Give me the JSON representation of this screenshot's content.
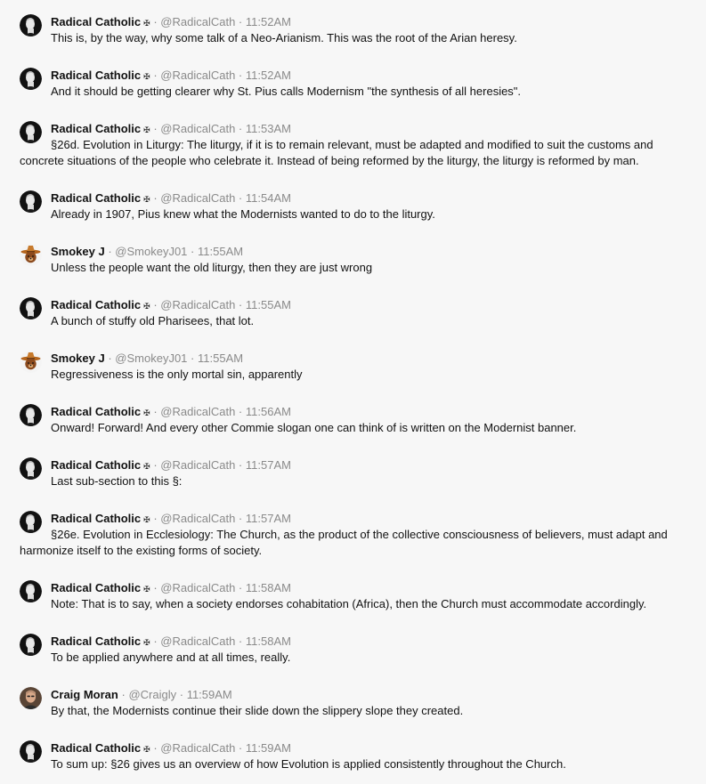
{
  "users": {
    "radical": {
      "name": "Radical Catholic",
      "badge": "✠",
      "handle": "@RadicalCath",
      "avatar": "radical-avatar-icon"
    },
    "smokey": {
      "name": "Smokey J",
      "handle": "@SmokeyJ01",
      "avatar": "smokey-bear-avatar-icon"
    },
    "craig": {
      "name": "Craig Moran",
      "handle": "@Craigly",
      "avatar": "craig-avatar-icon"
    }
  },
  "separator": "·",
  "posts": [
    {
      "user": "radical",
      "name": "Radical Catholic",
      "badge": "✠",
      "handle": "@RadicalCath",
      "time": "11:52AM",
      "text": "This is, by the way, why some talk of a Neo-Arianism. This was the root of the Arian heresy."
    },
    {
      "user": "radical",
      "name": "Radical Catholic",
      "badge": "✠",
      "handle": "@RadicalCath",
      "time": "11:52AM",
      "text": "And it should be getting clearer why St. Pius calls Modernism \"the synthesis of all heresies\"."
    },
    {
      "user": "radical",
      "name": "Radical Catholic",
      "badge": "✠",
      "handle": "@RadicalCath",
      "time": "11:53AM",
      "text": "§26d. Evolution in Liturgy: The liturgy, if it is to remain relevant, must be adapted and modified to suit the customs and concrete situations of the people who celebrate it. Instead of being reformed by the liturgy, the liturgy is reformed by man."
    },
    {
      "user": "radical",
      "name": "Radical Catholic",
      "badge": "✠",
      "handle": "@RadicalCath",
      "time": "11:54AM",
      "text": "Already in 1907, Pius knew what the Modernists wanted to do to the liturgy."
    },
    {
      "user": "smokey",
      "name": "Smokey J",
      "badge": "",
      "handle": "@SmokeyJ01",
      "time": "11:55AM",
      "text": "Unless the people want the old liturgy, then they are just wrong"
    },
    {
      "user": "radical",
      "name": "Radical Catholic",
      "badge": "✠",
      "handle": "@RadicalCath",
      "time": "11:55AM",
      "text": "A bunch of stuffy old Pharisees, that lot."
    },
    {
      "user": "smokey",
      "name": "Smokey J",
      "badge": "",
      "handle": "@SmokeyJ01",
      "time": "11:55AM",
      "text": "Regressiveness is the only mortal sin, apparently"
    },
    {
      "user": "radical",
      "name": "Radical Catholic",
      "badge": "✠",
      "handle": "@RadicalCath",
      "time": "11:56AM",
      "text": "Onward! Forward! And every other Commie slogan one can think of is written on the Modernist banner."
    },
    {
      "user": "radical",
      "name": "Radical Catholic",
      "badge": "✠",
      "handle": "@RadicalCath",
      "time": "11:57AM",
      "text": "Last sub-section to this §:"
    },
    {
      "user": "radical",
      "name": "Radical Catholic",
      "badge": "✠",
      "handle": "@RadicalCath",
      "time": "11:57AM",
      "text": "§26e. Evolution in Ecclesiology: The Church, as the product of the collective consciousness of believers, must adapt and harmonize itself to the existing forms of society."
    },
    {
      "user": "radical",
      "name": "Radical Catholic",
      "badge": "✠",
      "handle": "@RadicalCath",
      "time": "11:58AM",
      "text": "Note: That is to say, when a society endorses cohabitation (Africa), then the Church must accommodate accordingly."
    },
    {
      "user": "radical",
      "name": "Radical Catholic",
      "badge": "✠",
      "handle": "@RadicalCath",
      "time": "11:58AM",
      "text": "To be applied anywhere and at all times, really."
    },
    {
      "user": "craig",
      "name": "Craig Moran",
      "badge": "",
      "handle": "@Craigly",
      "time": "11:59AM",
      "text": "By that, the Modernists continue their slide down the slippery slope they created."
    },
    {
      "user": "radical",
      "name": "Radical Catholic",
      "badge": "✠",
      "handle": "@RadicalCath",
      "time": "11:59AM",
      "text": "To sum up: §26 gives us an overview of how Evolution is applied consistently throughout the Church."
    }
  ]
}
